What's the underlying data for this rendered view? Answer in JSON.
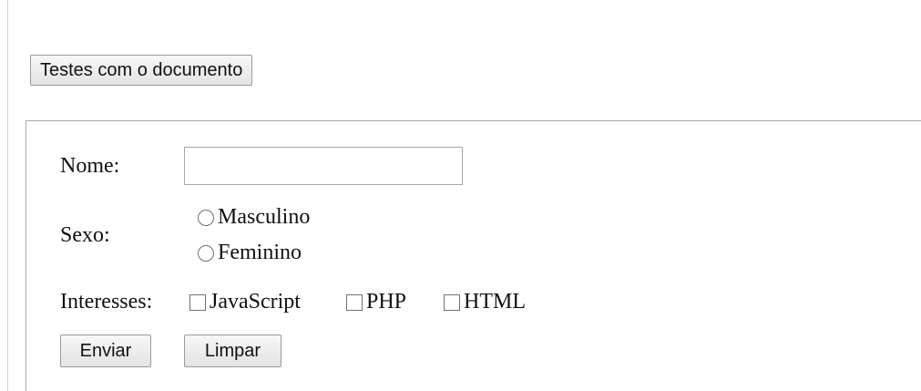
{
  "header": {
    "document_button_label": "Testes com o documento"
  },
  "form": {
    "name_label": "Nome:",
    "name_value": "",
    "name_placeholder": "",
    "sex_label": "Sexo:",
    "sex_options": [
      "Masculino",
      "Feminino"
    ],
    "interests_label": "Interesses:",
    "interest_options": [
      "JavaScript",
      "PHP",
      "HTML"
    ],
    "submit_label": "Enviar",
    "clear_label": "Limpar"
  },
  "icons": {
    "radio": "radio-button-icon",
    "checkbox": "checkbox-icon"
  },
  "colors": {
    "background": "#ffffff",
    "border": "#a8a8a8",
    "button_background": "#eeeeee",
    "text": "#111111"
  }
}
